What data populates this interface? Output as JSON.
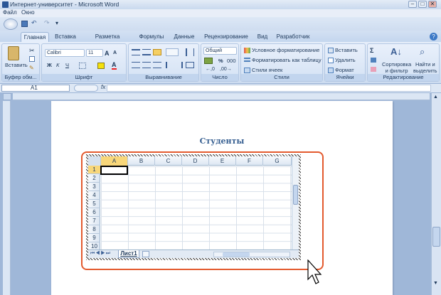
{
  "window": {
    "title": "Интернет-университет - Microsoft Word",
    "minimize": "–",
    "maximize": "□",
    "close": "✕"
  },
  "menu": {
    "file": "Файл",
    "window": "Окно"
  },
  "qat": {
    "dropdown": "▾"
  },
  "tabs": [
    {
      "label": "Главная"
    },
    {
      "label": "Вставка"
    },
    {
      "label": "Разметка страницы"
    },
    {
      "label": "Формулы"
    },
    {
      "label": "Данные"
    },
    {
      "label": "Рецензирование"
    },
    {
      "label": "Вид"
    },
    {
      "label": "Разработчик"
    }
  ],
  "ribbon": {
    "clipboard": {
      "paste": "Вставить",
      "label": "Буфер обм..."
    },
    "font": {
      "name": "Calibri",
      "size": "11",
      "bold": "Ж",
      "italic": "К",
      "underline": "Ч",
      "label": "Шрифт"
    },
    "alignment": {
      "label": "Выравнивание"
    },
    "number": {
      "format": "Общий",
      "percent": "%",
      "thousands": "000",
      "label": "Число"
    },
    "styles": {
      "conditional": "Условное форматирование",
      "table": "Форматировать как таблицу",
      "cell": "Стили ячеек",
      "label": "Стили"
    },
    "cells": {
      "insert": "Вставить",
      "delete": "Удалить",
      "format": "Формат",
      "label": "Ячейки"
    },
    "editing": {
      "sigma": "Σ",
      "sort": "Сортировка\nи фильтр",
      "find": "Найти и\nвыделить",
      "label": "Редактирование"
    }
  },
  "formula": {
    "namebox": "A1",
    "fx": "fx"
  },
  "document": {
    "title": "Студенты"
  },
  "sheet": {
    "columns": [
      "A",
      "B",
      "C",
      "D",
      "E",
      "F",
      "G"
    ],
    "rows": [
      "1",
      "2",
      "3",
      "4",
      "5",
      "6",
      "7",
      "8",
      "9",
      "10"
    ],
    "tab": "Лист1"
  },
  "colors": {
    "accent": "#e35a2e",
    "ribbon": "#cddcf0"
  }
}
